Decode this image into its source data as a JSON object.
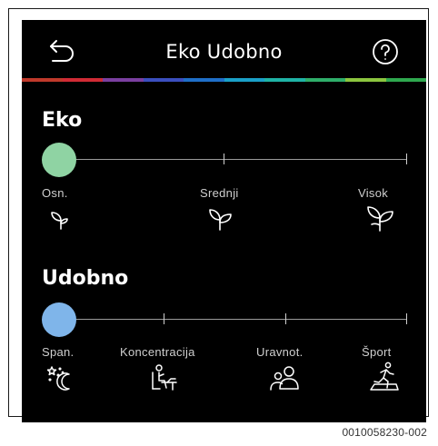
{
  "header": {
    "title": "Eko Udobno",
    "back_icon": "back-arrow-icon",
    "help_icon": "help-circle-icon"
  },
  "rainbow_colors": [
    "#c0392b",
    "#d12b35",
    "#7b3fa0",
    "#3b4fbf",
    "#1f6fc8",
    "#1aa0c8",
    "#1fb3a6",
    "#2fae6a",
    "#8cc63f",
    "#2fa84f"
  ],
  "eko": {
    "title": "Eko",
    "accent": "#8fd3a3",
    "value": 0,
    "levels": [
      {
        "label": "Osn.",
        "icon": "sprout-small-icon"
      },
      {
        "label": "Srednji",
        "icon": "sprout-medium-icon"
      },
      {
        "label": "Visok",
        "icon": "sprout-large-icon"
      }
    ]
  },
  "udobno": {
    "title": "Udobno",
    "accent": "#7fb5ea",
    "value": 0,
    "levels": [
      {
        "label": "Span.",
        "icon": "moon-stars-icon"
      },
      {
        "label": "Koncentracija",
        "icon": "person-at-desk-icon"
      },
      {
        "label": "Uravnot.",
        "icon": "two-persons-icon"
      },
      {
        "label": "Šport",
        "icon": "person-running-icon"
      }
    ]
  },
  "figure_ref": "0010058230-002"
}
